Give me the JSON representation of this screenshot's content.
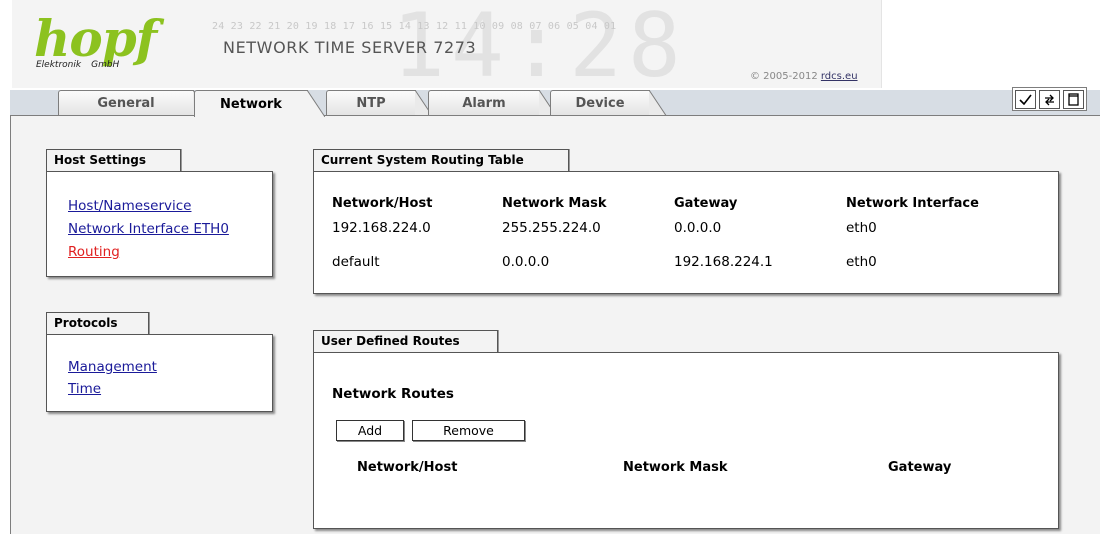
{
  "header": {
    "logo_text": "hopf",
    "logo_sub_left": "Elektronik",
    "logo_sub_right": "GmbH",
    "channel_numbers": "24 23 22 21 20 19 18 17 16 15 14 13 12 11 10 09 08 07 06 05 04 01",
    "product_title": "NETWORK TIME SERVER 7273",
    "copyright_prefix": "© 2005-2012 ",
    "copyright_link": "rdcs.eu",
    "background_digits": "14:28"
  },
  "tabs": [
    {
      "label": "General",
      "active": false
    },
    {
      "label": "Network",
      "active": true
    },
    {
      "label": "NTP",
      "active": false
    },
    {
      "label": "Alarm",
      "active": false
    },
    {
      "label": "Device",
      "active": false
    }
  ],
  "toolbar": {
    "apply_icon": "check-icon",
    "reload_icon": "reload-icon",
    "new_window_icon": "window-icon"
  },
  "host_settings": {
    "title": "Host Settings",
    "links": [
      "Host/Nameservice",
      "Network Interface ETH0",
      "Routing"
    ],
    "current": "Routing"
  },
  "protocols": {
    "title": "Protocols",
    "links": [
      "Management",
      "Time"
    ]
  },
  "routing_table": {
    "title": "Current System Routing Table",
    "columns": [
      "Network/Host",
      "Network Mask",
      "Gateway",
      "Network Interface"
    ],
    "rows": [
      [
        "192.168.224.0",
        "255.255.224.0",
        "0.0.0.0",
        "eth0"
      ],
      [
        "default",
        "0.0.0.0",
        "192.168.224.1",
        "eth0"
      ]
    ]
  },
  "user_routes": {
    "title": "User Defined Routes",
    "subtitle": "Network Routes",
    "add_label": "Add",
    "remove_label": "Remove",
    "columns": [
      "Network/Host",
      "Network Mask",
      "Gateway"
    ]
  },
  "colors": {
    "logo_green": "#8cc21f",
    "link_blue": "#1a1a99",
    "link_current": "#e02020",
    "content_bg": "#f3f3f3"
  }
}
